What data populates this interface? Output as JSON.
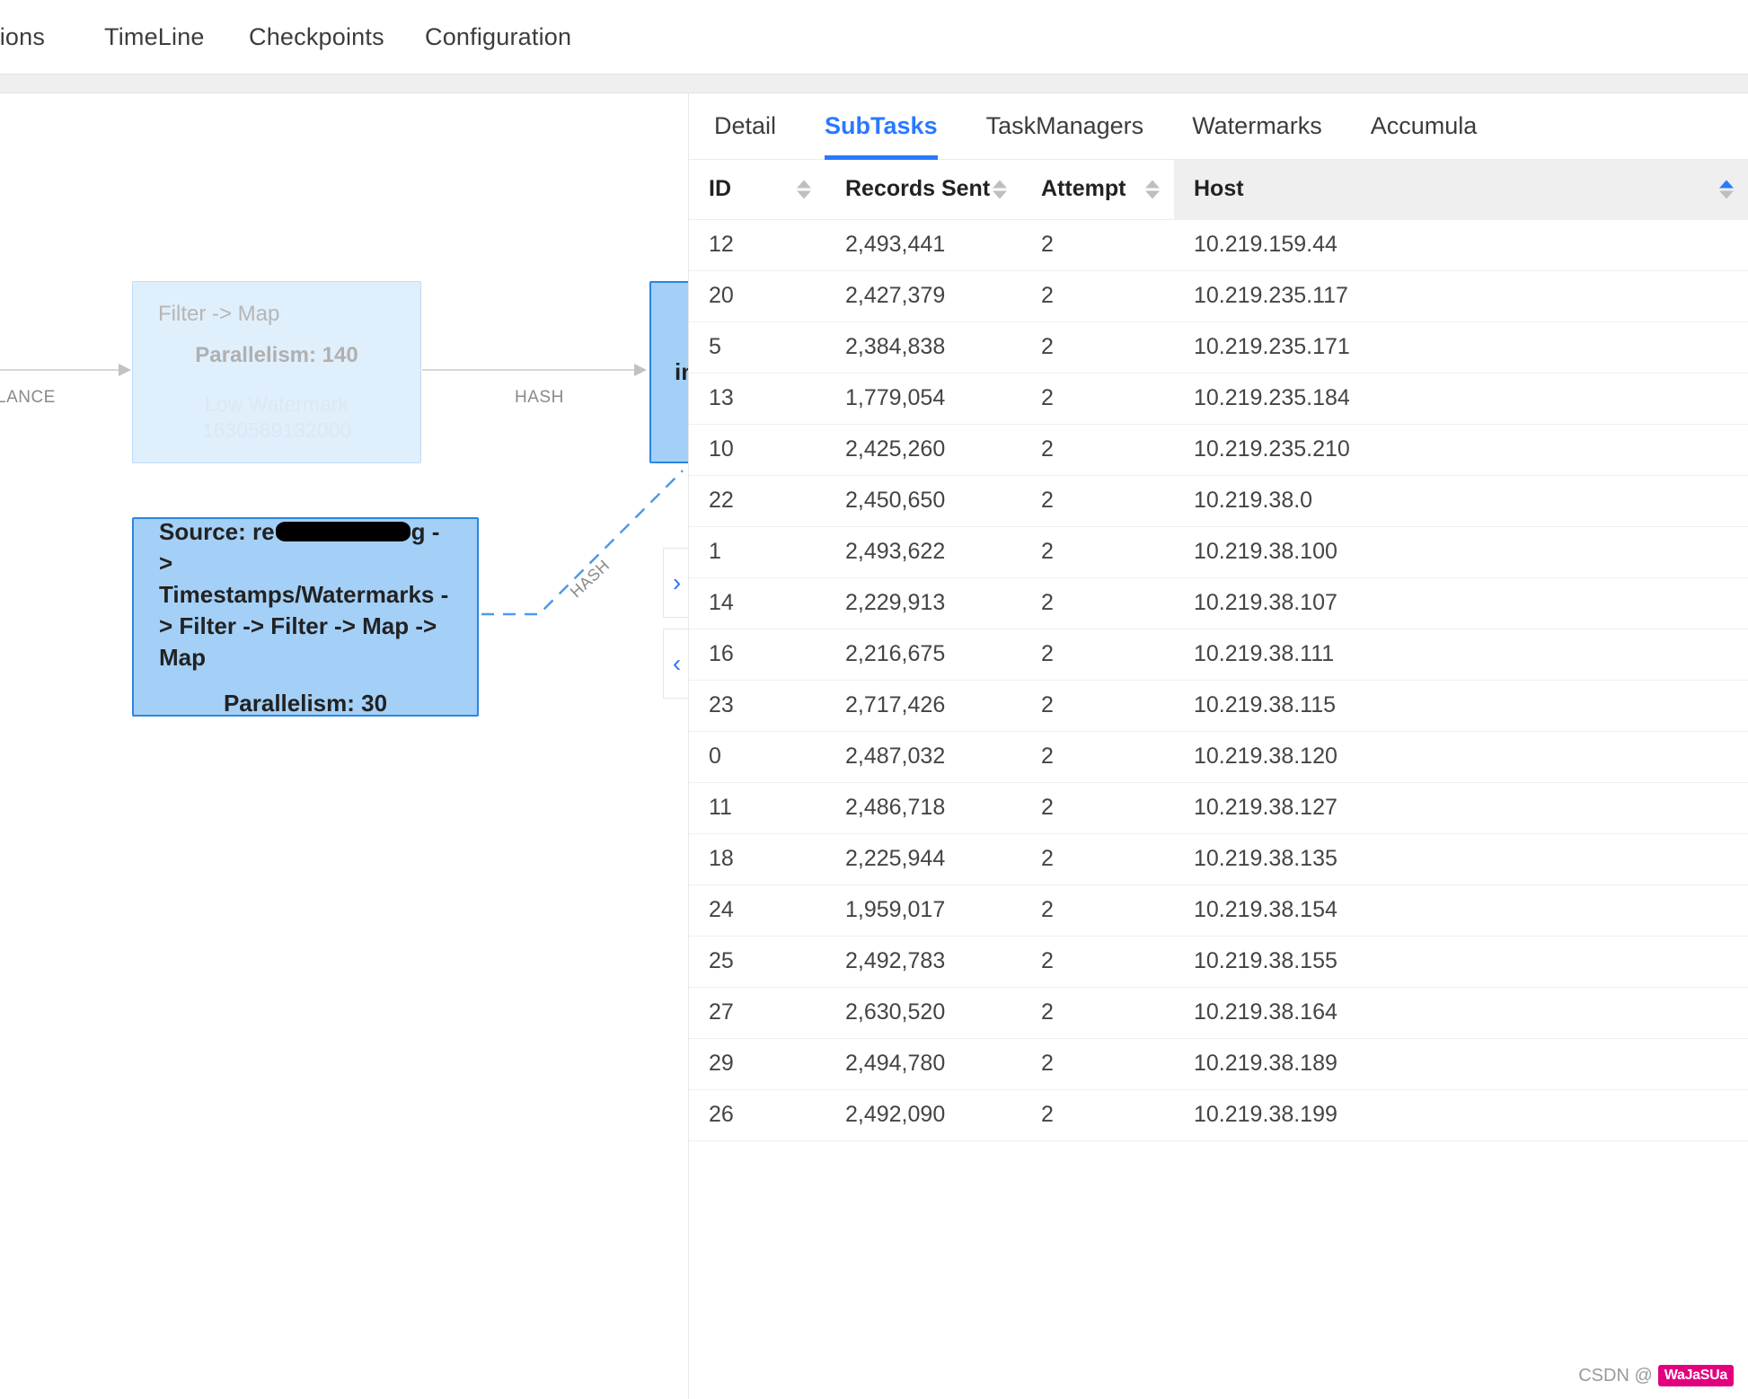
{
  "topnav": {
    "items": [
      {
        "label": "tions"
      },
      {
        "label": "TimeLine"
      },
      {
        "label": "Checkpoints"
      },
      {
        "label": "Configuration"
      }
    ]
  },
  "graph": {
    "nodes": [
      {
        "id": "filter-map",
        "title": "Filter -> Map",
        "parallelism": "Parallelism: 140",
        "watermark_label": "Low Watermark",
        "watermark_value": "1630589132000"
      },
      {
        "id": "source",
        "title_prefix": "Source: re",
        "title_suffix": "g -> Timestamps/Watermarks -> Filter -> Filter -> Map -> Map",
        "parallelism": "Parallelism: 30"
      },
      {
        "id": "downstream",
        "title": "in"
      }
    ],
    "edge_labels": [
      "HASH",
      "HASH"
    ],
    "balance_label": "LANCE"
  },
  "panel": {
    "tabs": [
      {
        "label": "Detail",
        "active": false
      },
      {
        "label": "SubTasks",
        "active": true
      },
      {
        "label": "TaskManagers",
        "active": false
      },
      {
        "label": "Watermarks",
        "active": false
      },
      {
        "label": "Accumula",
        "active": false
      }
    ],
    "columns": [
      {
        "key": "id",
        "label": "ID",
        "sortable": true,
        "sorted": false
      },
      {
        "key": "records_sent",
        "label": "Records Sent",
        "sortable": true,
        "sorted": false
      },
      {
        "key": "attempt",
        "label": "Attempt",
        "sortable": true,
        "sorted": false
      },
      {
        "key": "host",
        "label": "Host",
        "sortable": true,
        "sorted": true
      }
    ],
    "rows": [
      {
        "id": "12",
        "records_sent": "2,493,441",
        "attempt": "2",
        "host": "10.219.159.44"
      },
      {
        "id": "20",
        "records_sent": "2,427,379",
        "attempt": "2",
        "host": "10.219.235.117"
      },
      {
        "id": "5",
        "records_sent": "2,384,838",
        "attempt": "2",
        "host": "10.219.235.171"
      },
      {
        "id": "13",
        "records_sent": "1,779,054",
        "attempt": "2",
        "host": "10.219.235.184"
      },
      {
        "id": "10",
        "records_sent": "2,425,260",
        "attempt": "2",
        "host": "10.219.235.210"
      },
      {
        "id": "22",
        "records_sent": "2,450,650",
        "attempt": "2",
        "host": "10.219.38.0"
      },
      {
        "id": "1",
        "records_sent": "2,493,622",
        "attempt": "2",
        "host": "10.219.38.100"
      },
      {
        "id": "14",
        "records_sent": "2,229,913",
        "attempt": "2",
        "host": "10.219.38.107"
      },
      {
        "id": "16",
        "records_sent": "2,216,675",
        "attempt": "2",
        "host": "10.219.38.111"
      },
      {
        "id": "23",
        "records_sent": "2,717,426",
        "attempt": "2",
        "host": "10.219.38.115"
      },
      {
        "id": "0",
        "records_sent": "2,487,032",
        "attempt": "2",
        "host": "10.219.38.120"
      },
      {
        "id": "11",
        "records_sent": "2,486,718",
        "attempt": "2",
        "host": "10.219.38.127"
      },
      {
        "id": "18",
        "records_sent": "2,225,944",
        "attempt": "2",
        "host": "10.219.38.135"
      },
      {
        "id": "24",
        "records_sent": "1,959,017",
        "attempt": "2",
        "host": "10.219.38.154"
      },
      {
        "id": "25",
        "records_sent": "2,492,783",
        "attempt": "2",
        "host": "10.219.38.155"
      },
      {
        "id": "27",
        "records_sent": "2,630,520",
        "attempt": "2",
        "host": "10.219.38.164"
      },
      {
        "id": "29",
        "records_sent": "2,494,780",
        "attempt": "2",
        "host": "10.219.38.189"
      },
      {
        "id": "26",
        "records_sent": "2,492,090",
        "attempt": "2",
        "host": "10.219.38.199"
      }
    ]
  },
  "handles": {
    "expand": "›",
    "collapse": "‹"
  },
  "watermark": {
    "prefix": "CSDN @",
    "badge": "WaJaSUa"
  },
  "colors": {
    "accent": "#2979ff",
    "node_selected": "#a4d0f7",
    "node_faded": "#e0effc"
  }
}
